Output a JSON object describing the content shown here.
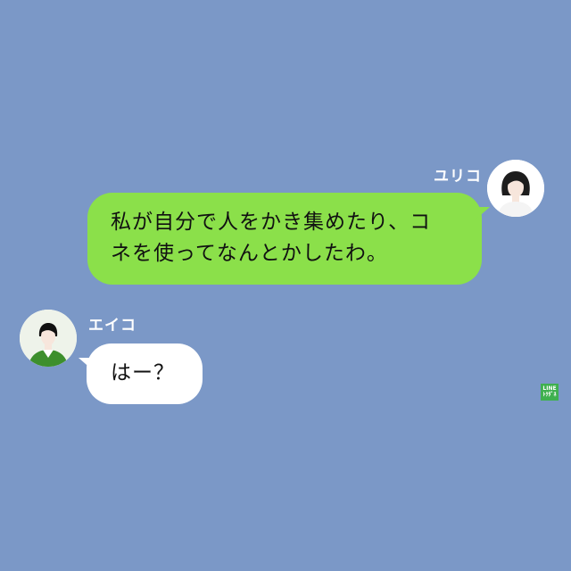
{
  "theme": {
    "background": "#7b98c7",
    "outgoing_bubble": "#8be04a",
    "incoming_bubble": "#ffffff",
    "name_color": "#ffffff"
  },
  "messages": [
    {
      "sender": "ユリコ",
      "side": "right",
      "lines": [
        "私が自分で人をかき集めたり、コ",
        "ネを使ってなんとかしたわ。"
      ],
      "avatar_icon": "woman-avatar-icon"
    },
    {
      "sender": "エイコ",
      "side": "left",
      "lines": [
        "はー？"
      ],
      "avatar_icon": "green-top-avatar-icon"
    }
  ],
  "watermark": {
    "line1": "LINE",
    "line2": "ﾄｸﾀﾞﾈ",
    "icon": "line-watermark-logo"
  }
}
